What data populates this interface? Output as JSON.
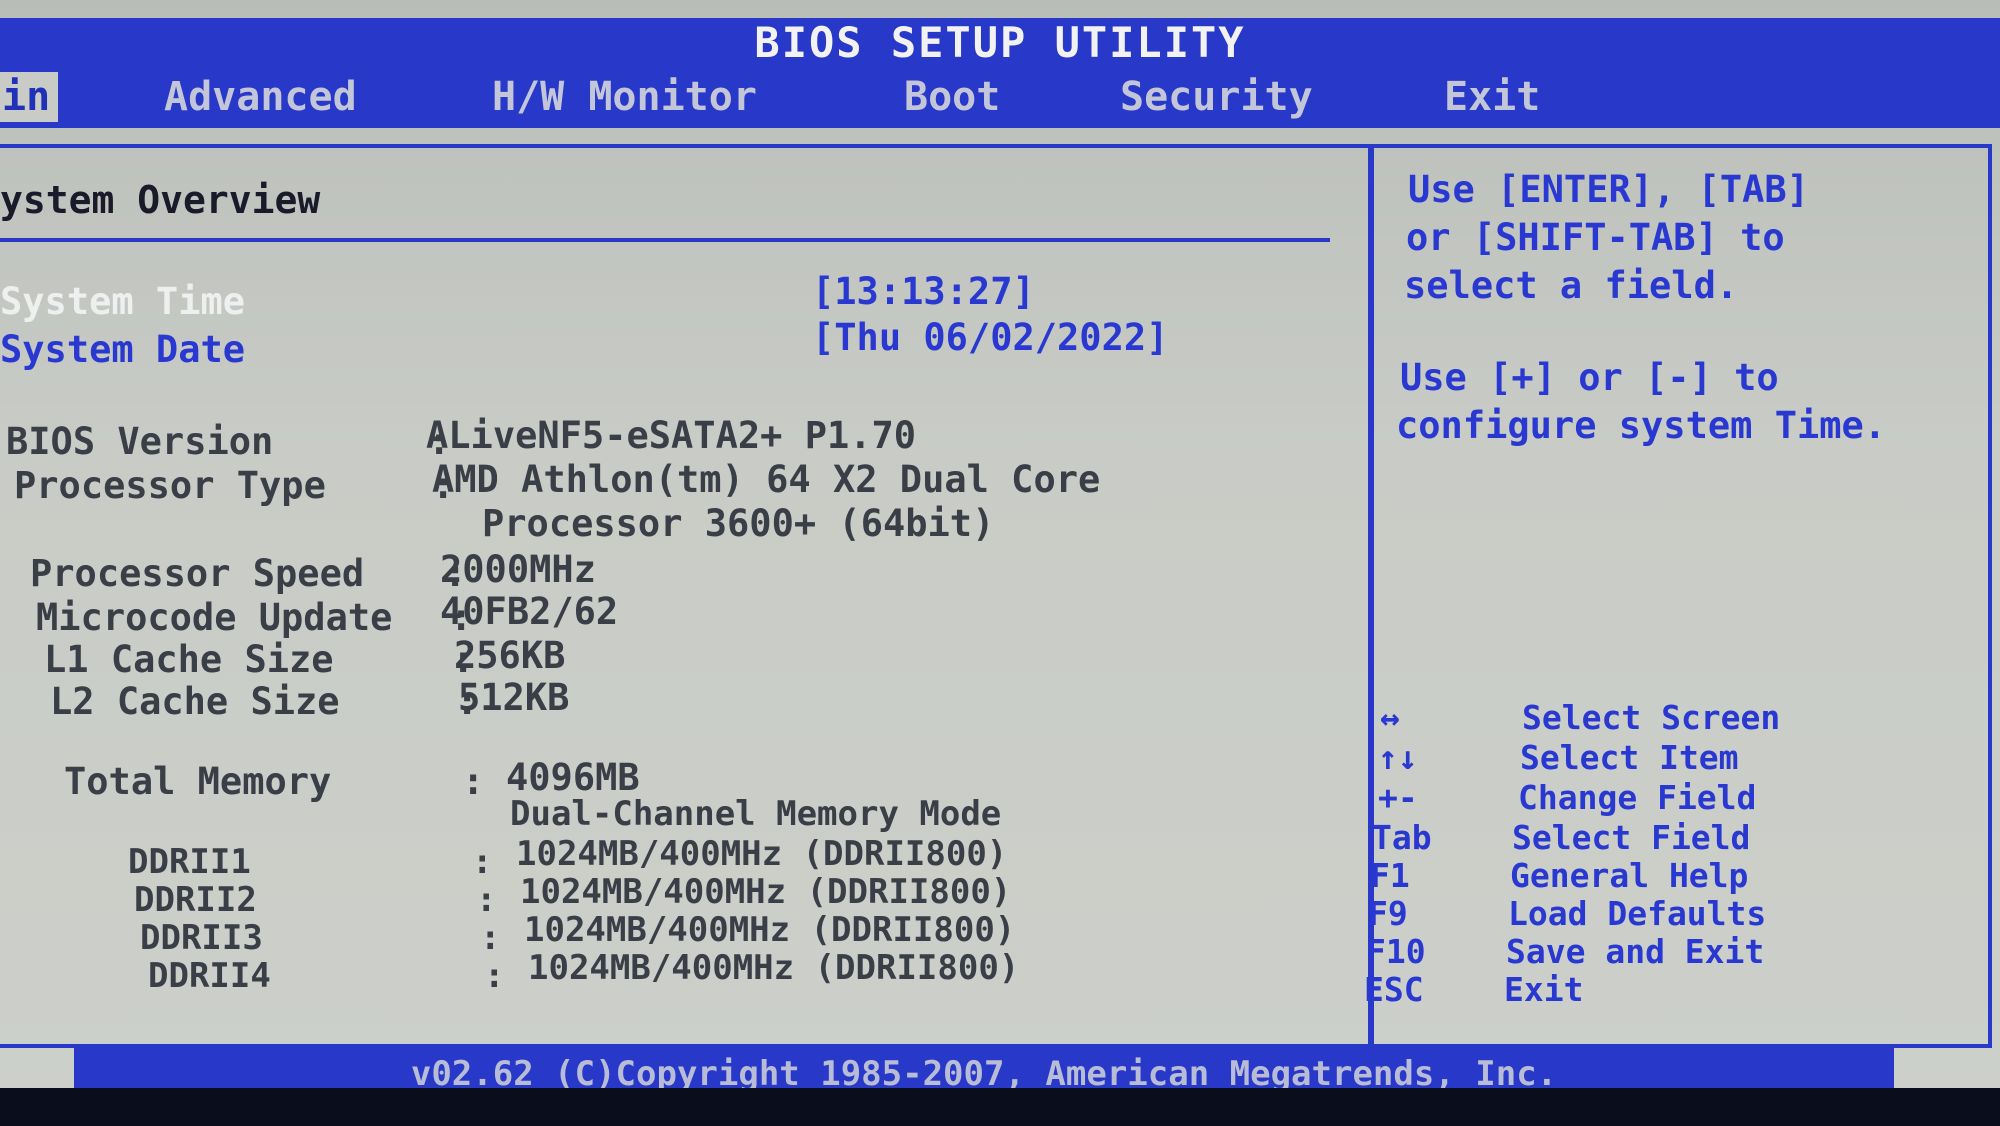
{
  "title": "BIOS SETUP UTILITY",
  "tabs": [
    "in",
    "Advanced",
    "H/W Monitor",
    "Boot",
    "Security",
    "Exit"
  ],
  "section_title": "ystem Overview",
  "system_time": {
    "label": "System Time",
    "value": "[13:13:27]"
  },
  "system_date": {
    "label": "System Date",
    "value": "[Thu 06/02/2022]"
  },
  "info": [
    {
      "label": "BIOS Version",
      "value": "ALiveNF5-eSATA2+ P1.70"
    },
    {
      "label": "Processor Type",
      "value": "AMD Athlon(tm) 64 X2 Dual Core",
      "value2": "Processor 3600+ (64bit)"
    },
    {
      "label": "Processor Speed",
      "value": "2000MHz"
    },
    {
      "label": "Microcode Update",
      "value": "40FB2/62"
    },
    {
      "label": "L1 Cache Size",
      "value": "256KB"
    },
    {
      "label": "L2 Cache Size",
      "value": "512KB"
    }
  ],
  "memory": {
    "label": "Total Memory",
    "value": "4096MB",
    "mode": "Dual-Channel Memory Mode",
    "slots": [
      {
        "label": "DDRII1",
        "value": "1024MB/400MHz (DDRII800)"
      },
      {
        "label": "DDRII2",
        "value": "1024MB/400MHz (DDRII800)"
      },
      {
        "label": "DDRII3",
        "value": "1024MB/400MHz (DDRII800)"
      },
      {
        "label": "DDRII4",
        "value": "1024MB/400MHz (DDRII800)"
      }
    ]
  },
  "help": {
    "lines1": [
      "Use [ENTER], [TAB]",
      "or [SHIFT-TAB] to",
      "select a field."
    ],
    "lines2": [
      "Use [+] or [-] to",
      "configure system Time."
    ]
  },
  "keys": [
    {
      "key": "↔",
      "desc": "Select Screen"
    },
    {
      "key": "↑↓",
      "desc": "Select Item"
    },
    {
      "key": "+-",
      "desc": "Change Field"
    },
    {
      "key": "Tab",
      "desc": "Select Field"
    },
    {
      "key": "F1",
      "desc": "General Help"
    },
    {
      "key": "F9",
      "desc": "Load Defaults"
    },
    {
      "key": "F10",
      "desc": "Save and Exit"
    },
    {
      "key": "ESC",
      "desc": "Exit"
    }
  ],
  "footer": "v02.62 (C)Copyright 1985-2007, American Megatrends, Inc."
}
